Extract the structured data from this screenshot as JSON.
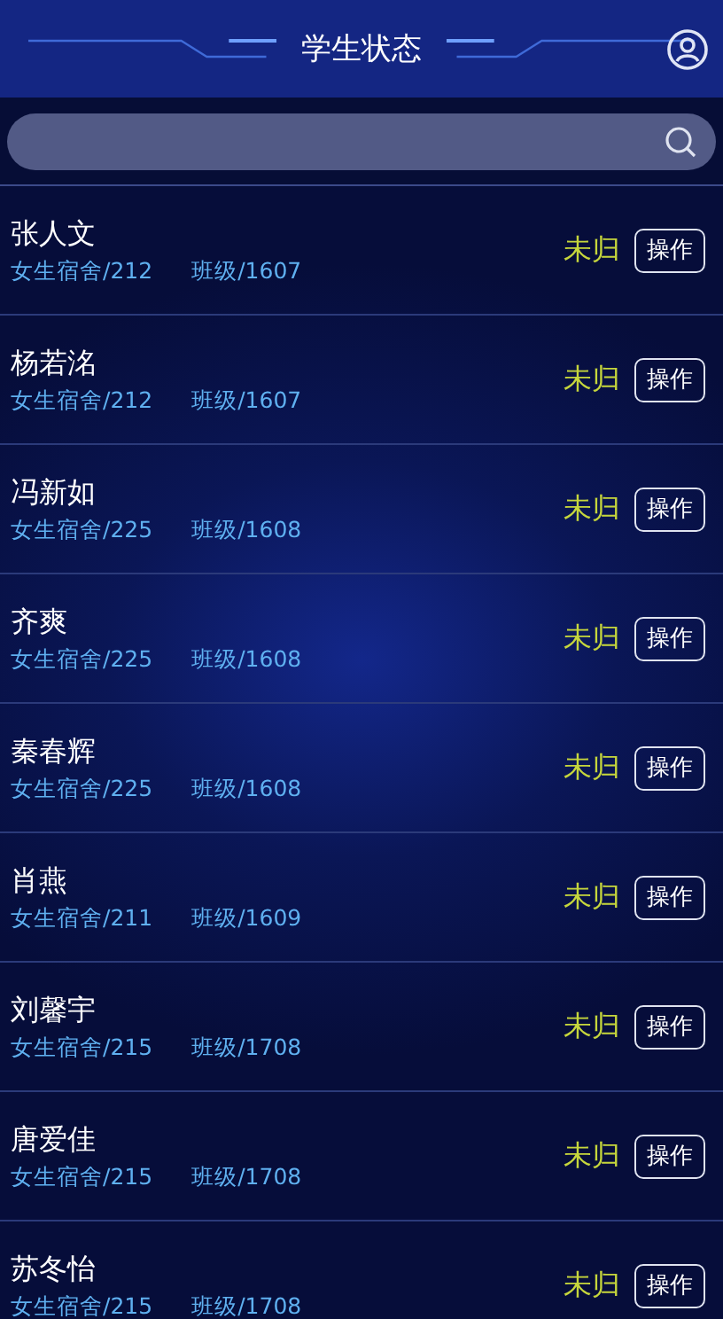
{
  "header": {
    "title": "学生状态"
  },
  "students": [
    {
      "name": "张人文",
      "dorm": "女生宿舍/212",
      "class": "班级/1607",
      "status": "未归",
      "action": "操作"
    },
    {
      "name": "杨若洺",
      "dorm": "女生宿舍/212",
      "class": "班级/1607",
      "status": "未归",
      "action": "操作"
    },
    {
      "name": "冯新如",
      "dorm": "女生宿舍/225",
      "class": "班级/1608",
      "status": "未归",
      "action": "操作"
    },
    {
      "name": "齐爽",
      "dorm": "女生宿舍/225",
      "class": "班级/1608",
      "status": "未归",
      "action": "操作"
    },
    {
      "name": "秦春辉",
      "dorm": "女生宿舍/225",
      "class": "班级/1608",
      "status": "未归",
      "action": "操作"
    },
    {
      "name": "肖燕",
      "dorm": "女生宿舍/211",
      "class": "班级/1609",
      "status": "未归",
      "action": "操作"
    },
    {
      "name": "刘馨宇",
      "dorm": "女生宿舍/215",
      "class": "班级/1708",
      "status": "未归",
      "action": "操作"
    },
    {
      "name": "唐爱佳",
      "dorm": "女生宿舍/215",
      "class": "班级/1708",
      "status": "未归",
      "action": "操作"
    },
    {
      "name": "苏冬怡",
      "dorm": "女生宿舍/215",
      "class": "班级/1708",
      "status": "未归",
      "action": "操作"
    }
  ]
}
